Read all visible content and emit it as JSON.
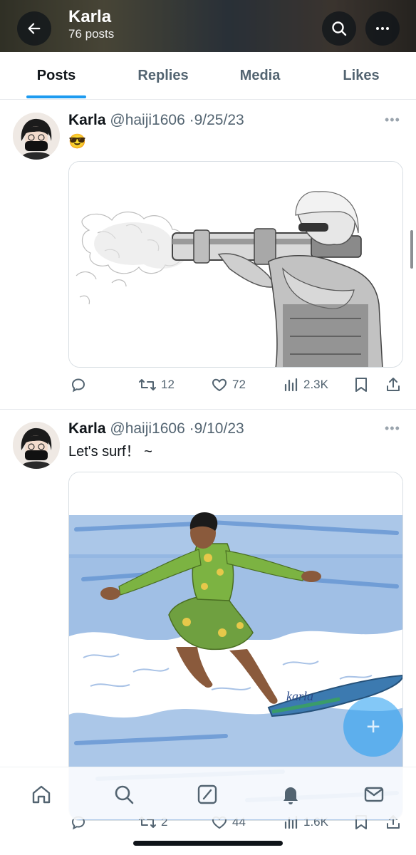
{
  "header": {
    "name": "Karla",
    "post_count": "76 posts",
    "back_icon": "arrow-left-icon",
    "search_icon": "search-icon",
    "more_icon": "more-horizontal-icon"
  },
  "tabs": [
    {
      "label": "Posts",
      "active": true
    },
    {
      "label": "Replies",
      "active": false
    },
    {
      "label": "Media",
      "active": false
    },
    {
      "label": "Likes",
      "active": false
    }
  ],
  "posts": [
    {
      "name": "Karla",
      "handle": "@haiji1606",
      "separator": "·",
      "date": "9/25/23",
      "text": "😎",
      "media_description_icon": "illustration-bazooka",
      "replies": "",
      "reposts": "12",
      "likes": "72",
      "views": "2.3K"
    },
    {
      "name": "Karla",
      "handle": "@haiji1606",
      "separator": "·",
      "date": "9/10/23",
      "text": "Let's surf！ ~",
      "media_description_icon": "illustration-surfer",
      "media_signature": "karla",
      "replies": "",
      "reposts": "2",
      "likes": "44",
      "views": "1.6K"
    }
  ],
  "fab": {
    "icon": "compose-plus-icon"
  },
  "bottom_nav": [
    "home-icon",
    "search-icon",
    "grok-icon",
    "notifications-bell-icon",
    "messages-mail-icon"
  ],
  "colors": {
    "accent": "#1d9bf0",
    "text": "#0f1419",
    "secondary": "#536471"
  }
}
